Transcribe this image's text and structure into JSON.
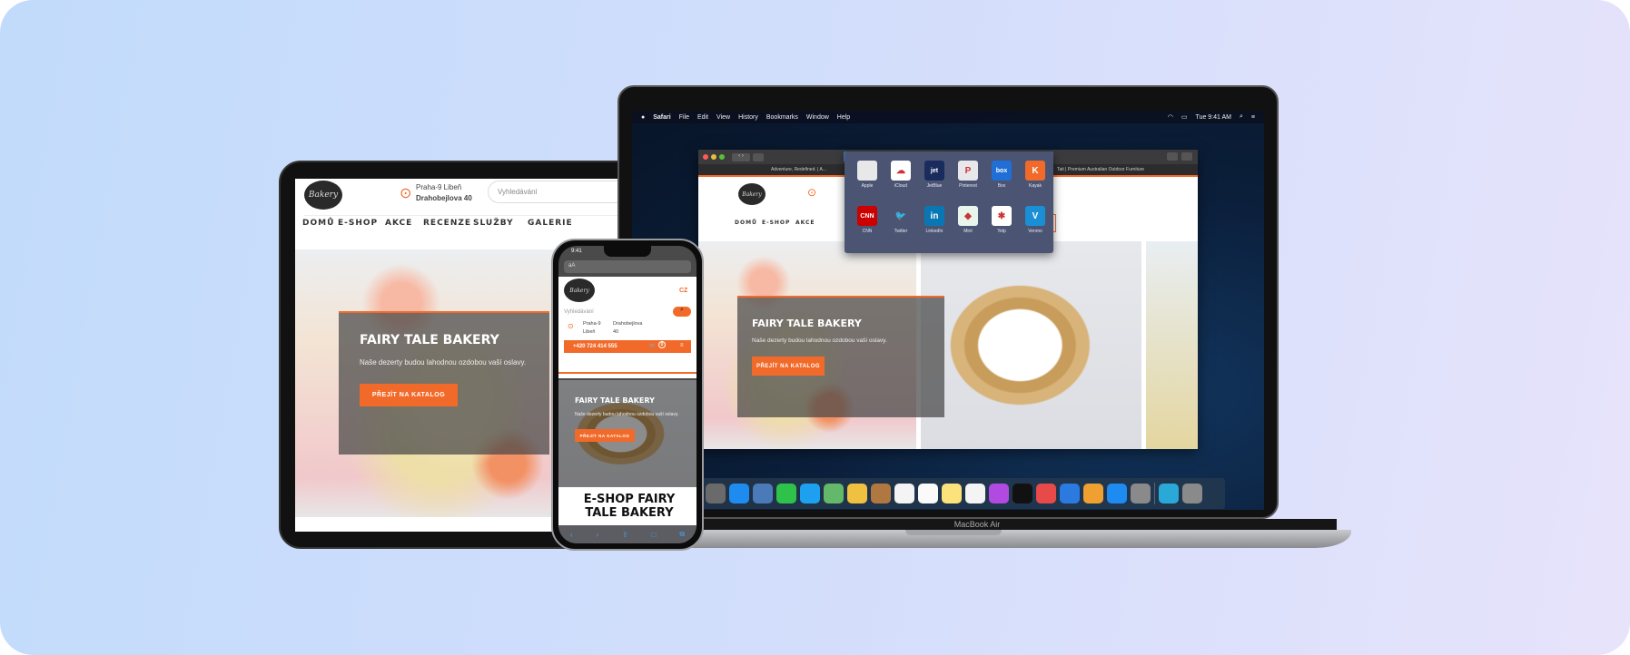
{
  "site": {
    "logo_text": "Bakery",
    "location_line1": "Praha-9 Libeň",
    "location_line2": "Drahobejlova 40",
    "search_placeholder": "Vyhledávání",
    "nav": [
      "DOMŮ",
      "E-SHOP",
      "AKCE",
      "RECENZE",
      "SLUŽBY",
      "GALERIE"
    ],
    "phone": "+420 724 414 555",
    "lang": "CZ",
    "cart_count": "0",
    "hero_title": "FAIRY TALE BAKERY",
    "hero_text": "Naše dezerty budou lahodnou ozdobou vaší oslavy.",
    "hero_button": "PŘEJÍT NA KATALOG",
    "eshop_heading": "E-SHOP FAIRY TALE BAKERY",
    "phone_loc1a": "Praha-9",
    "phone_loc1b": "Libeň",
    "phone_loc2a": "Drahobejlova",
    "phone_loc2b": "40",
    "accent": "#f26a2a"
  },
  "mac": {
    "menu": [
      "Safari",
      "File",
      "Edit",
      "View",
      "History",
      "Bookmarks",
      "Window",
      "Help"
    ],
    "clock": "Tue 9:41 AM",
    "tabs": [
      "Adventure, Redefined. | A...",
      "Tait | Premium Australian Outdoor Furniture"
    ],
    "favorites": [
      {
        "label": "Apple",
        "glyph": "",
        "color": "#e8e8e8"
      },
      {
        "label": "iCloud",
        "glyph": "☁",
        "color": "#ffffff"
      },
      {
        "label": "JetBlue",
        "glyph": "jet",
        "color": "#1a2b5e"
      },
      {
        "label": "Pinterest",
        "glyph": "P",
        "color": "#e8e8ea"
      },
      {
        "label": "Box",
        "glyph": "box",
        "color": "#1f6fd6"
      },
      {
        "label": "Kayak",
        "glyph": "K",
        "color": "#f26a2a"
      },
      {
        "label": "CNN",
        "glyph": "CNN",
        "color": "#cc0000"
      },
      {
        "label": "Twitter",
        "glyph": "🐦",
        "color": "#4b5573"
      },
      {
        "label": "LinkedIn",
        "glyph": "in",
        "color": "#0a77b5"
      },
      {
        "label": "Mint",
        "glyph": "◆",
        "color": "#e8f5ec"
      },
      {
        "label": "Yelp",
        "glyph": "✱",
        "color": "#ffffff"
      },
      {
        "label": "Venmo",
        "glyph": "V",
        "color": "#1a8fd6"
      }
    ],
    "dock_colors": [
      "#6a6a6a",
      "#1e8bf0",
      "#4a7ab8",
      "#2ec24a",
      "#1ea0f0",
      "#63b86a",
      "#f0c040",
      "#b07840",
      "#f4f4f4",
      "#fafafa",
      "#fce27a",
      "#f4f4f4",
      "#b04ae0",
      "#111111",
      "#e84a4a",
      "#2a7ae0",
      "#f0a030",
      "#1e8bf0",
      "#8a8a8a",
      "#2aa8d8",
      "#8a8a8a"
    ],
    "model": "MacBook Air"
  },
  "phone_ui": {
    "time": "9:41",
    "address": "aA"
  }
}
